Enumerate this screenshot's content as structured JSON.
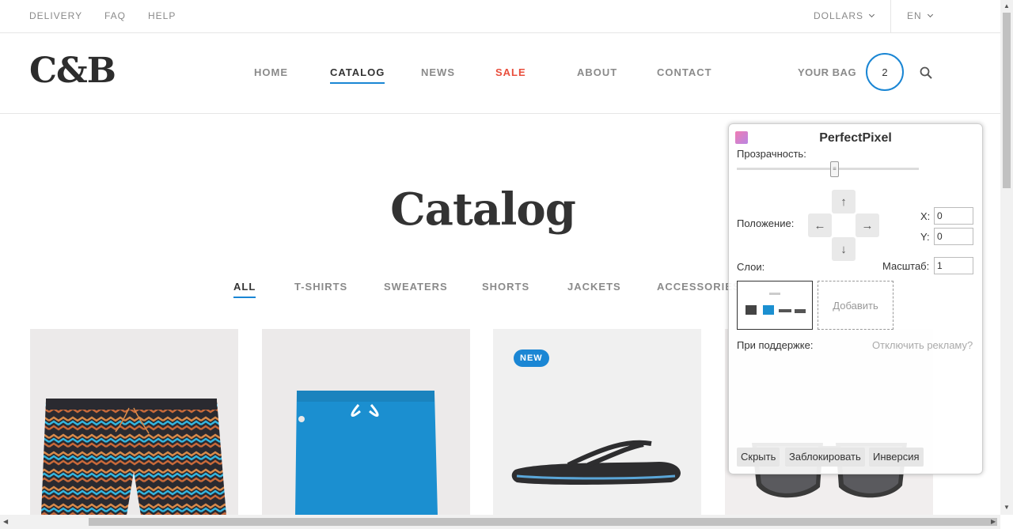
{
  "topbar": {
    "links": [
      "DELIVERY",
      "FAQ",
      "HELP"
    ],
    "currency": "DOLLARS",
    "language": "EN"
  },
  "header": {
    "logo": "C&B",
    "nav": [
      "HOME",
      "CATALOG",
      "NEWS",
      "SALE",
      "ABOUT",
      "CONTACT"
    ],
    "bag_label": "YOUR BAG",
    "bag_count": "2"
  },
  "catalog": {
    "title": "Catalog",
    "filters": [
      "ALL",
      "T-SHIRTS",
      "SWEATERS",
      "SHORTS",
      "JACKETS",
      "ACCESSORIES"
    ],
    "badge": "NEW"
  },
  "perfectpixel": {
    "title": "PerfectPixel",
    "opacity_label": "Прозрачность:",
    "position_label": "Положение:",
    "x_label": "X:",
    "y_label": "Y:",
    "x_value": "0",
    "y_value": "0",
    "layers_label": "Слои:",
    "scale_label": "Масштаб:",
    "scale_value": "1",
    "add_label": "Добавить",
    "support_label": "При поддержке:",
    "ads_link": "Отключить рекламу?",
    "hide_button": "Скрыть",
    "lock_button": "Заблокировать",
    "invert_button": "Инверсия"
  },
  "colors": {
    "accent": "#1a86d4",
    "sale": "#e94e3c"
  }
}
